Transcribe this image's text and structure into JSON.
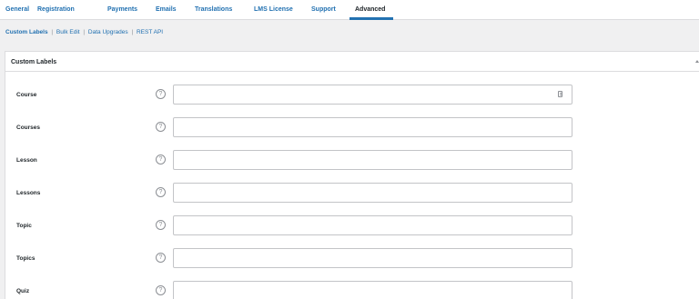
{
  "tabs": [
    {
      "label": "General"
    },
    {
      "label": "Registration"
    },
    {
      "label": "Payments"
    },
    {
      "label": "Emails"
    },
    {
      "label": "Translations"
    },
    {
      "label": "LMS License"
    },
    {
      "label": "Support"
    },
    {
      "label": "Advanced",
      "active": true
    }
  ],
  "subnav": [
    {
      "label": "Custom Labels",
      "current": true
    },
    {
      "label": "Bulk Edit"
    },
    {
      "label": "Data Upgrades"
    },
    {
      "label": "REST API"
    }
  ],
  "subnav_separator": "|",
  "panel": {
    "title": "Custom Labels",
    "collapse_icon": "triangle-up-icon"
  },
  "fields": [
    {
      "label": "Course",
      "value": "",
      "help_icon": "question-circle-icon",
      "has_field_icon": true
    },
    {
      "label": "Courses",
      "value": "",
      "help_icon": "question-circle-icon"
    },
    {
      "label": "Lesson",
      "value": "",
      "help_icon": "question-circle-icon"
    },
    {
      "label": "Lessons",
      "value": "",
      "help_icon": "question-circle-icon"
    },
    {
      "label": "Topic",
      "value": "",
      "help_icon": "question-circle-icon"
    },
    {
      "label": "Topics",
      "value": "",
      "help_icon": "question-circle-icon"
    },
    {
      "label": "Quiz",
      "value": "",
      "help_icon": "question-circle-icon"
    }
  ],
  "help_glyph": "?",
  "colors": {
    "accent": "#2271b1",
    "text": "#1d2327",
    "page_bg": "#f0f0f1",
    "border": "#dcdcde"
  }
}
